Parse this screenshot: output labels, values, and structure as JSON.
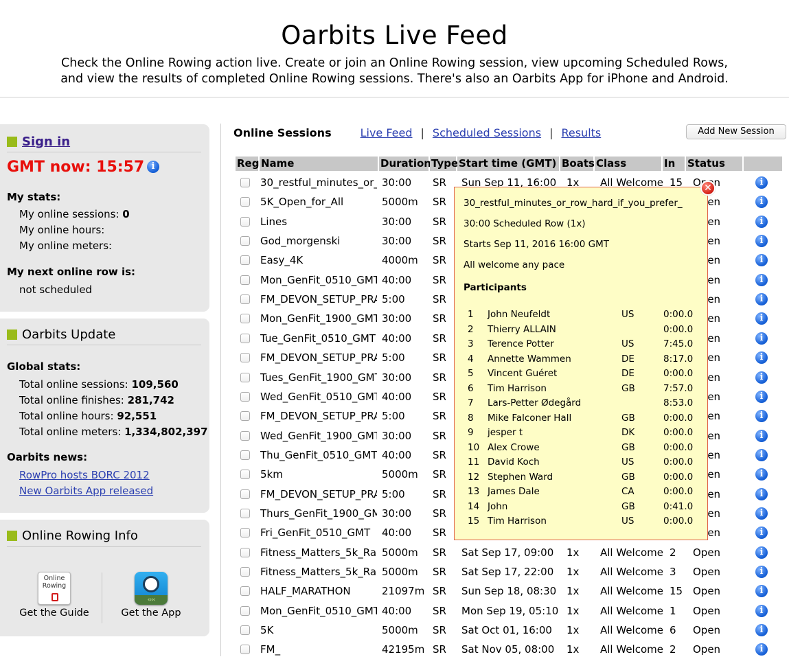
{
  "header": {
    "title": "Oarbits Live Feed",
    "intro_line1": "Check the Online Rowing action live. Create or join an Online Rowing session, view upcoming Scheduled Rows,",
    "intro_line2": "and view the results of completed Online Rowing sessions. There's also an Oarbits App for iPhone and Android."
  },
  "sidebar": {
    "sign_in": "Sign in",
    "gmt_now": "GMT now: 15:57",
    "my_stats_label": "My stats:",
    "my_sessions_label": "My online sessions:",
    "my_sessions_value": "0",
    "my_hours_label": "My online hours:",
    "my_meters_label": "My online meters:",
    "next_row_label": "My next online row is:",
    "next_row_value": "not scheduled",
    "update_title": "Oarbits Update",
    "global_stats_label": "Global stats:",
    "total_sessions_label": "Total online sessions:",
    "total_sessions_value": "109,560",
    "total_finishes_label": "Total online finishes:",
    "total_finishes_value": "281,742",
    "total_hours_label": "Total online hours:",
    "total_hours_value": "92,551",
    "total_meters_label": "Total online meters:",
    "total_meters_value": "1,334,802,397",
    "news_label": "Oarbits news:",
    "news_1": "RowPro hosts BORC 2012",
    "news_2": "New Oarbits App released",
    "info_title": "Online Rowing Info",
    "guide_icon_text": "Online Rowing",
    "guide_label": "Get the Guide",
    "app_label": "Get the App"
  },
  "main": {
    "title": "Online Sessions",
    "nav_live": "Live Feed",
    "nav_sep": "|",
    "nav_scheduled": "Scheduled Sessions",
    "nav_results": "Results",
    "add_button": "Add New Session"
  },
  "table": {
    "headers": {
      "reg": "Reg",
      "name": "Name",
      "duration": "Duration",
      "type": "Type",
      "start": "Start time (GMT)",
      "boats": "Boats",
      "class": "Class",
      "in": "In",
      "status": "Status"
    },
    "rows": [
      {
        "name": "30_restful_minutes_or_",
        "duration": "30:00",
        "type": "SR",
        "start": "Sun Sep 11, 16:00",
        "boats": "1x",
        "class": "All Welcome",
        "in": "15",
        "status": "Open"
      },
      {
        "name": "5K_Open_for_All",
        "duration": "5000m",
        "type": "SR",
        "start": "",
        "boats": "",
        "class": "",
        "in": "",
        "status": "Open"
      },
      {
        "name": "Lines",
        "duration": "30:00",
        "type": "SR",
        "start": "",
        "boats": "",
        "class": "",
        "in": "",
        "status": "Open"
      },
      {
        "name": "God_morgenski",
        "duration": "30:00",
        "type": "SR",
        "start": "",
        "boats": "",
        "class": "",
        "in": "",
        "status": "Open"
      },
      {
        "name": "Easy_4K",
        "duration": "4000m",
        "type": "SR",
        "start": "",
        "boats": "",
        "class": "",
        "in": "",
        "status": "Open"
      },
      {
        "name": "Mon_GenFit_0510_GMT",
        "duration": "40:00",
        "type": "SR",
        "start": "",
        "boats": "",
        "class": "",
        "in": "",
        "status": "Open"
      },
      {
        "name": "FM_DEVON_SETUP_PRAC",
        "duration": "5:00",
        "type": "SR",
        "start": "",
        "boats": "",
        "class": "",
        "in": "",
        "status": "Open"
      },
      {
        "name": "Mon_GenFit_1900_GMT",
        "duration": "30:00",
        "type": "SR",
        "start": "",
        "boats": "",
        "class": "",
        "in": "",
        "status": "Open"
      },
      {
        "name": "Tue_GenFit_0510_GMT",
        "duration": "40:00",
        "type": "SR",
        "start": "",
        "boats": "",
        "class": "",
        "in": "",
        "status": "Open"
      },
      {
        "name": "FM_DEVON_SETUP_PRAC",
        "duration": "5:00",
        "type": "SR",
        "start": "",
        "boats": "",
        "class": "",
        "in": "",
        "status": "Open"
      },
      {
        "name": "Tues_GenFit_1900_GMT",
        "duration": "30:00",
        "type": "SR",
        "start": "",
        "boats": "",
        "class": "",
        "in": "",
        "status": "Open"
      },
      {
        "name": "Wed_GenFit_0510_GMT",
        "duration": "40:00",
        "type": "SR",
        "start": "",
        "boats": "",
        "class": "",
        "in": "",
        "status": "Open"
      },
      {
        "name": "FM_DEVON_SETUP_PRAC",
        "duration": "5:00",
        "type": "SR",
        "start": "",
        "boats": "",
        "class": "",
        "in": "",
        "status": "Open"
      },
      {
        "name": "Wed_GenFit_1900_GMT",
        "duration": "30:00",
        "type": "SR",
        "start": "",
        "boats": "",
        "class": "",
        "in": "",
        "status": "Open"
      },
      {
        "name": "Thu_GenFit_0510_GMT",
        "duration": "40:00",
        "type": "SR",
        "start": "",
        "boats": "",
        "class": "",
        "in": "",
        "status": "Open"
      },
      {
        "name": "5km",
        "duration": "5000m",
        "type": "SR",
        "start": "",
        "boats": "",
        "class": "",
        "in": "",
        "status": "Open"
      },
      {
        "name": "FM_DEVON_SETUP_PRAC",
        "duration": "5:00",
        "type": "SR",
        "start": "",
        "boats": "",
        "class": "",
        "in": "",
        "status": "Open"
      },
      {
        "name": "Thurs_GenFit_1900_GM",
        "duration": "30:00",
        "type": "SR",
        "start": "",
        "boats": "",
        "class": "",
        "in": "",
        "status": "Open"
      },
      {
        "name": "Fri_GenFit_0510_GMT",
        "duration": "40:00",
        "type": "SR",
        "start": "",
        "boats": "",
        "class": "",
        "in": "",
        "status": "Open"
      },
      {
        "name": "Fitness_Matters_5k_Rac",
        "duration": "5000m",
        "type": "SR",
        "start": "Sat Sep 17, 09:00",
        "boats": "1x",
        "class": "All Welcome",
        "in": "2",
        "status": "Open"
      },
      {
        "name": "Fitness_Matters_5k_Rac",
        "duration": "5000m",
        "type": "SR",
        "start": "Sat Sep 17, 22:00",
        "boats": "1x",
        "class": "All Welcome",
        "in": "3",
        "status": "Open"
      },
      {
        "name": "HALF_MARATHON",
        "duration": "21097m",
        "type": "SR",
        "start": "Sun Sep 18, 08:30",
        "boats": "1x",
        "class": "All Welcome",
        "in": "15",
        "status": "Open"
      },
      {
        "name": "Mon_GenFit_0510_GMT",
        "duration": "40:00",
        "type": "SR",
        "start": "Mon Sep 19, 05:10",
        "boats": "1x",
        "class": "All Welcome",
        "in": "1",
        "status": "Open"
      },
      {
        "name": "5K",
        "duration": "5000m",
        "type": "SR",
        "start": "Sat Oct 01, 16:00",
        "boats": "1x",
        "class": "All Welcome",
        "in": "6",
        "status": "Open"
      },
      {
        "name": "FM_",
        "duration": "42195m",
        "type": "SR",
        "start": "Sat Nov 05, 08:00",
        "boats": "1x",
        "class": "All Welcome",
        "in": "2",
        "status": "Open"
      }
    ]
  },
  "popup": {
    "session_name": "30_restful_minutes_or_row_hard_if_you_prefer_",
    "row_desc": "30:00 Scheduled Row (1x)",
    "starts": "Starts Sep 11, 2016 16:00 GMT",
    "welcome": "All welcome any pace",
    "participants_title": "Participants",
    "close_icon_glyph": "✕",
    "participants": [
      {
        "num": "1",
        "name": "John Neufeldt",
        "country": "US",
        "time": "0:00.0"
      },
      {
        "num": "2",
        "name": "Thierry ALLAIN",
        "country": "",
        "time": "0:00.0"
      },
      {
        "num": "3",
        "name": "Terence Potter",
        "country": "US",
        "time": "7:45.0"
      },
      {
        "num": "4",
        "name": "Annette Wammen",
        "country": "DE",
        "time": "8:17.0"
      },
      {
        "num": "5",
        "name": "Vincent Guéret",
        "country": "DE",
        "time": "0:00.0"
      },
      {
        "num": "6",
        "name": "Tim Harrison",
        "country": "GB",
        "time": "7:57.0"
      },
      {
        "num": "7",
        "name": "Lars-Petter Ødegård",
        "country": "",
        "time": "8:53.0"
      },
      {
        "num": "8",
        "name": "Mike Falconer Hall",
        "country": "GB",
        "time": "0:00.0"
      },
      {
        "num": "9",
        "name": "jesper t",
        "country": "DK",
        "time": "0:00.0"
      },
      {
        "num": "10",
        "name": "Alex Crowe",
        "country": "GB",
        "time": "0:00.0"
      },
      {
        "num": "11",
        "name": "David Koch",
        "country": "US",
        "time": "0:00.0"
      },
      {
        "num": "12",
        "name": "Stephen Ward",
        "country": "GB",
        "time": "0:00.0"
      },
      {
        "num": "13",
        "name": "James Dale",
        "country": "CA",
        "time": "0:00.0"
      },
      {
        "num": "14",
        "name": "John",
        "country": "GB",
        "time": "0:41.0"
      },
      {
        "num": "15",
        "name": "Tim Harrison",
        "country": "US",
        "time": "0:00.0"
      }
    ]
  },
  "colors": {
    "accent_green": "#99bb1a",
    "gmt_red": "#e8100c",
    "link_blue": "#2b3fb0",
    "popup_bg": "#fefdc6",
    "popup_border": "#e0624a"
  }
}
